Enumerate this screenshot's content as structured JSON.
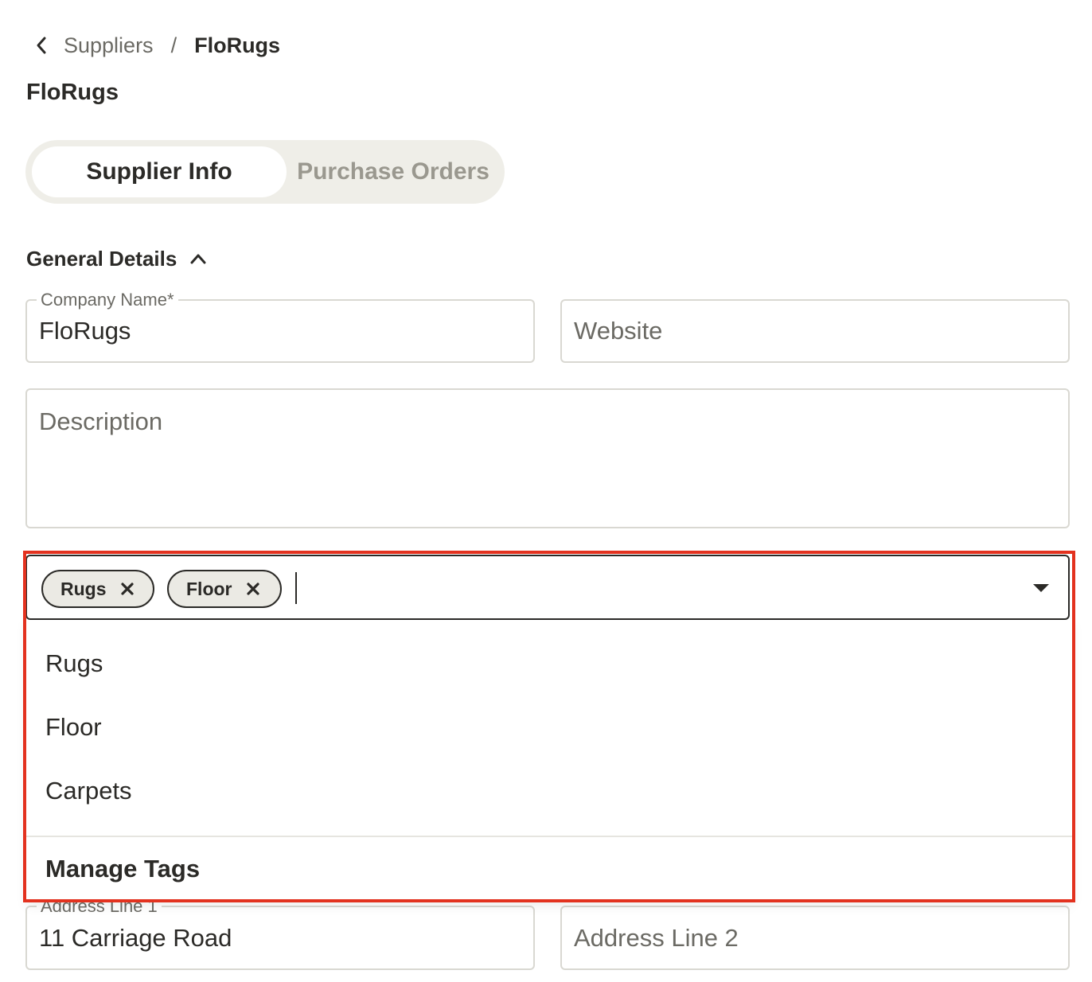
{
  "breadcrumb": {
    "parent": "Suppliers",
    "separator": "/",
    "current": "FloRugs"
  },
  "page": {
    "title": "FloRugs"
  },
  "tabs": [
    {
      "label": "Supplier Info",
      "active": true
    },
    {
      "label": "Purchase Orders",
      "active": false
    }
  ],
  "general_details": {
    "title": "General Details",
    "company_name": {
      "label": "Company Name*",
      "value": "FloRugs"
    },
    "website": {
      "placeholder": "Website"
    },
    "description": {
      "placeholder": "Description"
    }
  },
  "tags": {
    "selected": [
      "Rugs",
      "Floor"
    ],
    "options": [
      "Rugs",
      "Floor",
      "Carpets"
    ],
    "manage_label": "Manage Tags"
  },
  "address": {
    "line1": {
      "label": "Address Line 1",
      "value": "11 Carriage Road"
    },
    "line2": {
      "placeholder": "Address Line 2"
    }
  },
  "colors": {
    "text": "#2b2a27",
    "muted": "#6b6a64",
    "highlight": "#e3321f",
    "chip_bg": "#ebeae4",
    "tabs_bg": "#efeee8"
  },
  "icons": {
    "back": "chevron-left-icon",
    "collapse": "chevron-up-icon",
    "chip_remove": "close-icon",
    "dropdown": "triangle-down-icon"
  }
}
